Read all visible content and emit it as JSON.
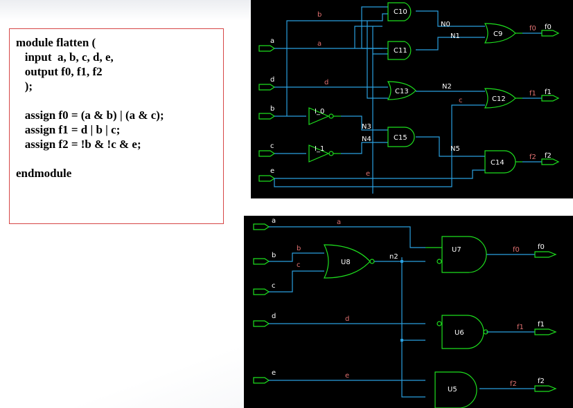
{
  "code": {
    "lines": [
      "module flatten (",
      "   input  a, b, c, d, e,",
      "   output f0, f1, f2",
      "   );",
      "",
      "   assign f0 = (a & b) | (a & c);",
      "   assign f1 = d | b | c;",
      "   assign f2 = !b & !c & e;",
      "",
      "endmodule"
    ]
  },
  "top_schematic": {
    "inputs": [
      "a",
      "d",
      "b",
      "c",
      "e"
    ],
    "wires": [
      "b",
      "a",
      "d",
      "N3",
      "N4",
      "e",
      "N0",
      "N1",
      "N2",
      "c",
      "N5",
      "f0",
      "f1",
      "f2"
    ],
    "gates": [
      "C10",
      "C11",
      "C13",
      "C15",
      "C9",
      "C12",
      "C14",
      "I_0",
      "I_1"
    ],
    "outputs": [
      "f0",
      "f1",
      "f2"
    ]
  },
  "bottom_schematic": {
    "inputs": [
      "a",
      "b",
      "c",
      "d",
      "e"
    ],
    "wires": [
      "a",
      "b",
      "c",
      "n2",
      "d",
      "e",
      "f0",
      "f1",
      "f2"
    ],
    "gates": [
      "U8",
      "U7",
      "U6",
      "U5"
    ],
    "outputs": [
      "f0",
      "f1",
      "f2"
    ]
  },
  "colors": {
    "panel_bg": "#000000",
    "wire": "#2aa0e0",
    "gate": "#1ee01e",
    "label": "#e07070",
    "code_border": "#d64545"
  }
}
